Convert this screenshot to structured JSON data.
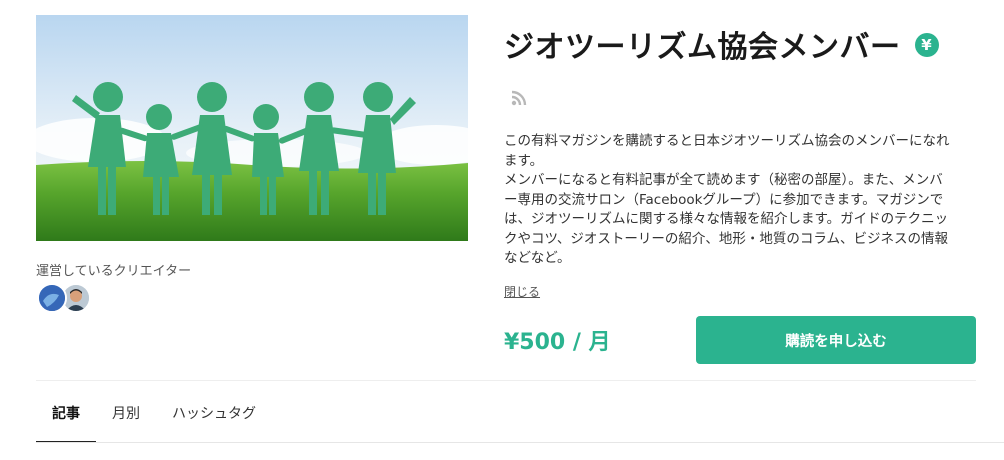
{
  "magazine": {
    "title": "ジオツーリズム協会メンバー",
    "paid_badge_icon": "yen-icon",
    "paid_badge_symbol": "¥",
    "rss_icon": "rss-icon",
    "description": "この有料マガジンを購読すると日本ジオツーリズム協会のメンバーになれ\nます。\nメンバーになると有料記事が全て読めます（秘密の部屋）。また、メンバ\nー専用の交流サロン（Facebookグループ）に参加できます。マガジンで\nは、ジオツーリズムに関する様々な情報を紹介します。ガイドのテクニッ\nクやコツ、ジオストーリーの紹介、地形・地質のコラム、ビジネスの情報\nなどなど。",
    "close_label": "閉じる",
    "price": "¥500 / 月",
    "subscribe_label": "購読を申し込む"
  },
  "creators": {
    "label": "運営しているクリエイター",
    "avatars": [
      "avatar-creator-1",
      "avatar-creator-2"
    ]
  },
  "tabs": [
    {
      "label": "記事",
      "active": true
    },
    {
      "label": "月別",
      "active": false
    },
    {
      "label": "ハッシュタグ",
      "active": false
    }
  ],
  "colors": {
    "accent": "#2bb38f",
    "figure_green": "#3dab77",
    "grass": "#4f9a2e",
    "sky": "#cfe3f5"
  }
}
